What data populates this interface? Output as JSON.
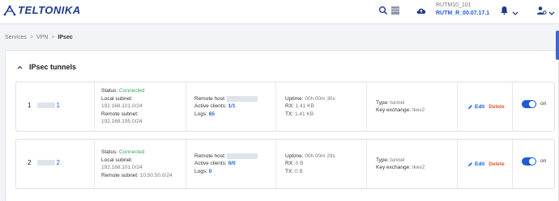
{
  "brand": {
    "logo_text": "TELTONIKA",
    "accent": "#1f3a8a",
    "link": "#1f5bd6",
    "ok": "#3ba55d",
    "danger": "#e05a2b"
  },
  "header": {
    "device_name": "RUTM10_101",
    "firmware": "RUTM_R_00.07.17.1"
  },
  "breadcrumb": {
    "items": [
      "Services",
      "VPN",
      "IPsec"
    ]
  },
  "panel": {
    "title": "IPsec tunnels"
  },
  "labels": {
    "status": "Status:",
    "local_subnet": "Local subnet:",
    "remote_subnet": "Remote subnet:",
    "remote_host": "Remote host:",
    "active_clients": "Active clients:",
    "logs": "Logs:",
    "uptime": "Uptime:",
    "rx": "RX:",
    "tx": "TX:",
    "type": "Type:",
    "key_exchange": "Key exchange:",
    "edit": "Edit",
    "delete": "Delete",
    "on": "on"
  },
  "tunnels": [
    {
      "index": "1",
      "suffix": "1",
      "status": "Connected",
      "local_subnet": "192.168.101.0/24",
      "remote_subnet": "192.168.195.0/24",
      "active_clients": "1/1",
      "logs": "65",
      "uptime": "00h 00m 30s",
      "rx": "1.41 KB",
      "tx": "1.41 KB",
      "type": "tunnel",
      "key_exchange": "Ikev2",
      "enabled": true
    },
    {
      "index": "2",
      "suffix": "2",
      "status": "Connected",
      "local_subnet": "192.168.101.0/24",
      "remote_subnet": "10.50.50.0/24",
      "active_clients": "0/0",
      "logs": "0",
      "uptime": "00h 00m 29s",
      "rx": "0 B",
      "tx": "0 B",
      "type": "tunnel",
      "key_exchange": "Ikev2",
      "enabled": true
    }
  ]
}
